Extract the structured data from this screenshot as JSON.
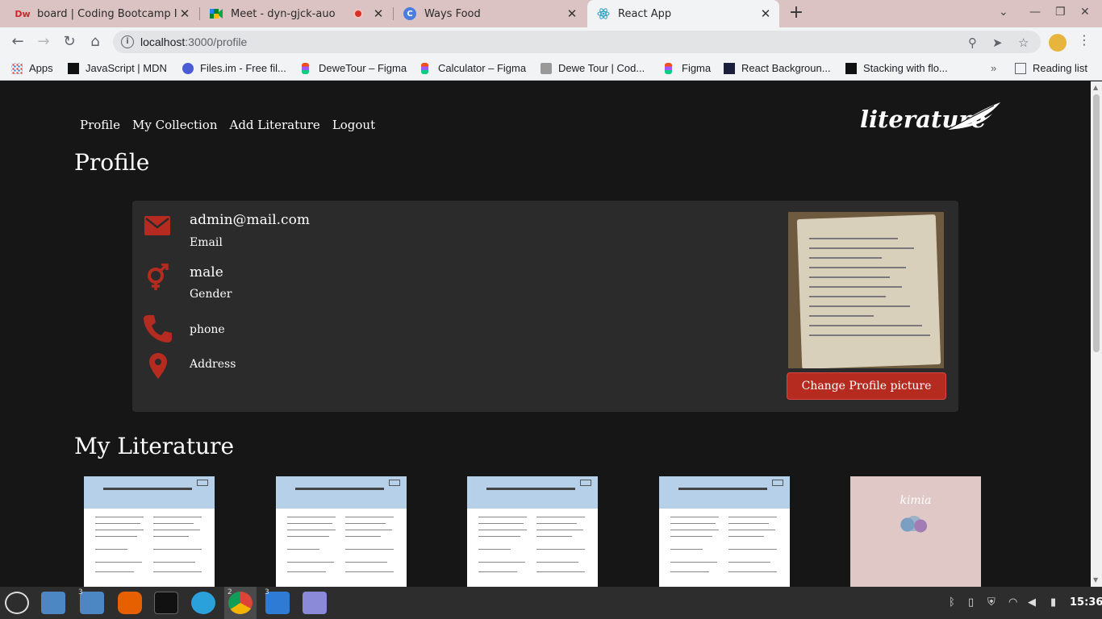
{
  "browser": {
    "tabs": [
      {
        "title": "board | Coding Bootcamp Ind",
        "favicon": "dumbways-icon"
      },
      {
        "title": "Meet - dyn-gjck-auo",
        "favicon": "google-meet-icon"
      },
      {
        "title": "Ways Food",
        "favicon": "waysfood-icon"
      },
      {
        "title": "React App",
        "favicon": "react-icon",
        "active": true
      }
    ],
    "url_host": "localhost",
    "url_path": ":3000/profile",
    "bookmarks": [
      {
        "label": "Apps"
      },
      {
        "label": "JavaScript | MDN"
      },
      {
        "label": "Files.im - Free fil..."
      },
      {
        "label": "DeweTour – Figma"
      },
      {
        "label": "Calculator – Figma"
      },
      {
        "label": "Dewe Tour | Cod..."
      },
      {
        "label": "Figma"
      },
      {
        "label": "React Backgroun..."
      },
      {
        "label": "Stacking with flo..."
      }
    ],
    "reading_list": "Reading list"
  },
  "site": {
    "nav": [
      "Profile",
      "My Collection",
      "Add Literature",
      "Logout"
    ],
    "logo_text": "literature",
    "page_title": "Profile",
    "profile": {
      "email": "admin@mail.com",
      "email_label": "Email",
      "gender": "male",
      "gender_label": "Gender",
      "phone_label": "phone",
      "address_label": "Address",
      "change_button": "Change Profile picture"
    },
    "section_title": "My Literature",
    "book_cover_text": "kimia"
  },
  "taskbar": {
    "clock": "15:36",
    "files_badge": "3",
    "chrome_badge": "2",
    "vscode_badge": "3"
  },
  "colors": {
    "accent": "#b52b20",
    "page_bg": "#161616",
    "card_bg": "#2b2b2b"
  }
}
